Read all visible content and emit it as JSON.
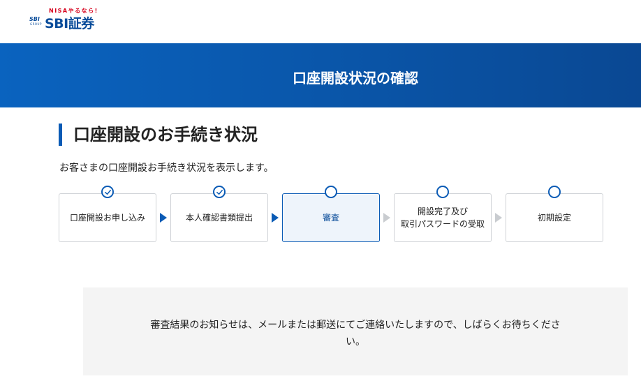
{
  "header": {
    "logo_tagline": "NISAやるなら!",
    "logo_mark": "SBI",
    "logo_mark_sub": "GROUP",
    "logo_brand": "SBI証券"
  },
  "banner": {
    "title": "口座開設状況の確認"
  },
  "section": {
    "title": "口座開設のお手続き状況",
    "description": "お客さまの口座開設お手続き状況を表示します。"
  },
  "steps": [
    {
      "label": "口座開設お申し込み",
      "status": "completed"
    },
    {
      "label": "本人確認書類提出",
      "status": "completed"
    },
    {
      "label": "審査",
      "status": "current"
    },
    {
      "label": "開設完了及び\n取引パスワードの受取",
      "status": "pending"
    },
    {
      "label": "初期設定",
      "status": "pending"
    }
  ],
  "notice": {
    "text": "審査結果のお知らせは、メールまたは郵送にてご連絡いたしますので、しばらくお待ちくださ\nい。"
  },
  "colors": {
    "brand_blue": "#0a5bb5",
    "banner_start": "#0a63bf",
    "banner_end": "#0a4893",
    "logo_red": "#d6001c",
    "arrow_inactive": "#c9ccd0",
    "notice_bg": "#f4f4f4"
  }
}
